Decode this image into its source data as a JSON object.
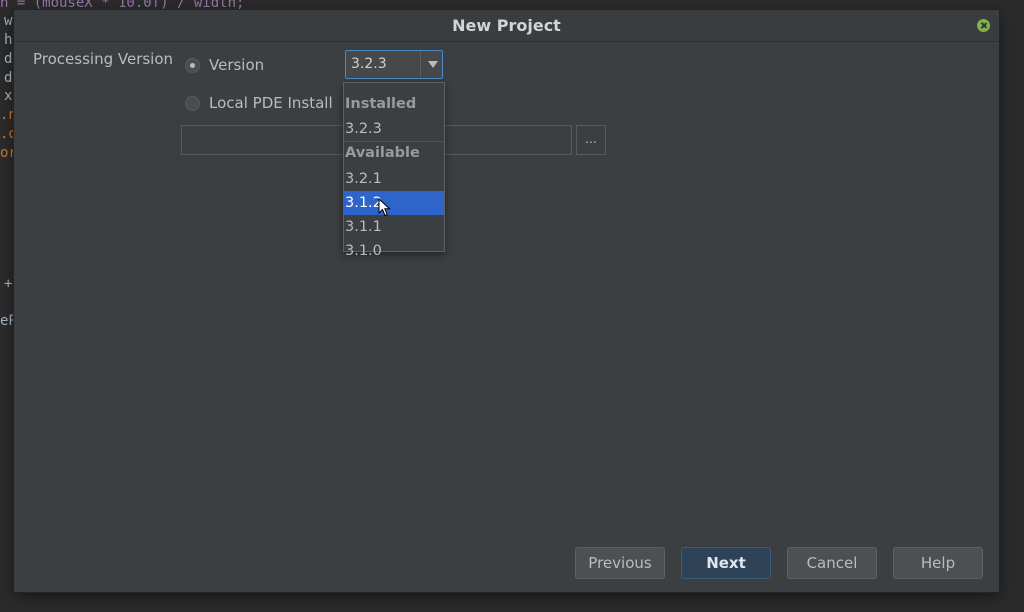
{
  "background_code": {
    "top_line": "n = (mouseX * 10.0f) / width;",
    "left_chars": [
      "w",
      "h",
      "d",
      "d",
      "x",
      ".n",
      ".o",
      "or",
      "+",
      "eP"
    ]
  },
  "dialog": {
    "title": "New Project",
    "close_icon": "close-icon",
    "processing_version_label": "Processing Version",
    "radio_version": {
      "label": "Version",
      "checked": true
    },
    "radio_local": {
      "label": "Local PDE Install",
      "checked": false
    },
    "version_combo": {
      "value": "3.2.3"
    },
    "path_field": {
      "value": ""
    },
    "browse_label": "...",
    "dropdown": {
      "installed_header": "Installed",
      "installed": [
        "3.2.3"
      ],
      "available_header": "Available",
      "available": [
        "3.2.1",
        "3.1.2",
        "3.1.1",
        "3.1.0"
      ],
      "selected": "3.1.2"
    },
    "buttons": {
      "previous": "Previous",
      "next": "Next",
      "cancel": "Cancel",
      "help": "Help"
    }
  },
  "colors": {
    "dialog_bg": "#3c3f41",
    "selection": "#2f65ca",
    "focus_border": "#4a88c7",
    "primary_button": "#2e4258"
  }
}
